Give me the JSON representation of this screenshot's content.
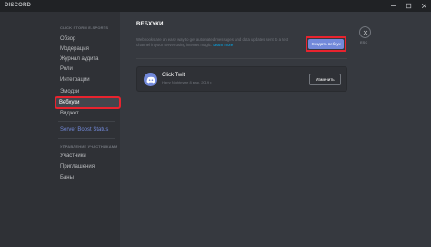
{
  "titlebar": {
    "app_name": "DISCORD",
    "icons": {
      "minimize": "minimize-icon",
      "maximize": "maximize-icon",
      "close": "close-icon"
    }
  },
  "sidebar": {
    "server_header": "CLICK STORM E-SPORTS",
    "items": [
      {
        "label": "Обзор",
        "selected": false
      },
      {
        "label": "Модерация",
        "selected": false
      },
      {
        "label": "Журнал аудита",
        "selected": false
      },
      {
        "label": "Роли",
        "selected": false
      },
      {
        "label": "Интеграции",
        "selected": false
      },
      {
        "label": "Эмодзи",
        "selected": false
      },
      {
        "label": "Вебхуки",
        "selected": true
      },
      {
        "label": "Виджет",
        "selected": false
      }
    ],
    "boost_status": "Server Boost Status",
    "members_header": "УПРАВЛЕНИЕ УЧАСТНИКАМИ",
    "member_items": [
      {
        "label": "Участники"
      },
      {
        "label": "Приглашения"
      },
      {
        "label": "Баны"
      }
    ]
  },
  "main": {
    "title": "ВЕБХУКИ",
    "description": "Webhooks are an easy way to get automated messages and data updates sent to a text channel in your server using internet magic.",
    "learn_more": "Learn more",
    "create_button": "Создать вебхук",
    "esc_label": "ESC",
    "webhook": {
      "name": "Click Twit",
      "meta": "Harry Nightmare 8 мар. 2019 г.",
      "edit_button": "Изменить"
    }
  },
  "colors": {
    "accent": "#7289da",
    "highlight": "#e8232e",
    "link": "#00b0f4"
  }
}
